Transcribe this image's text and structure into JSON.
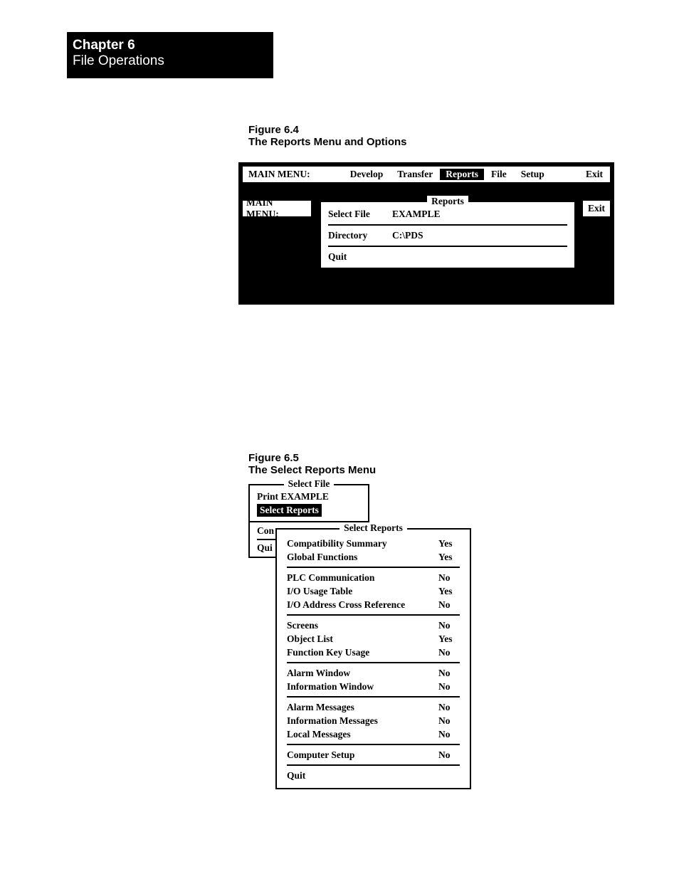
{
  "chapter": {
    "number": "Chapter 6",
    "title": "File Operations"
  },
  "figure64": {
    "caption_num": "Figure 6.4",
    "caption_text": "The Reports Menu and Options",
    "main_menu_label": "MAIN MENU:",
    "menu_items": {
      "develop": "Develop",
      "transfer": "Transfer",
      "reports": "Reports",
      "file": "File",
      "setup": "Setup",
      "exit": "Exit"
    },
    "sub": {
      "main_menu_label": "MAIN MENU:",
      "panel_title": "Reports",
      "select_file_label": "Select File",
      "select_file_value": "EXAMPLE",
      "directory_label": "Directory",
      "directory_value": "C:\\PDS",
      "quit_label": "Quit",
      "exit_label": "Exit"
    }
  },
  "figure65": {
    "caption_num": "Figure 6.5",
    "caption_text": "The Select Reports Menu",
    "select_file_title": "Select File",
    "print_label": "Print",
    "print_value": "EXAMPLE",
    "select_reports_label": "Select Reports",
    "back_item_con": "Con",
    "back_item_qui": "Qui",
    "panel_title": "Select Reports",
    "groups": [
      [
        {
          "label": "Compatibility Summary",
          "value": "Yes"
        },
        {
          "label": "Global Functions",
          "value": "Yes"
        }
      ],
      [
        {
          "label": "PLC Communication",
          "value": "No"
        },
        {
          "label": "I/O Usage Table",
          "value": "Yes"
        },
        {
          "label": "I/O Address Cross Reference",
          "value": "No"
        }
      ],
      [
        {
          "label": "Screens",
          "value": "No"
        },
        {
          "label": "Object List",
          "value": "Yes"
        },
        {
          "label": "Function Key Usage",
          "value": "No"
        }
      ],
      [
        {
          "label": "Alarm Window",
          "value": "No"
        },
        {
          "label": "Information Window",
          "value": "No"
        }
      ],
      [
        {
          "label": "Alarm Messages",
          "value": "No"
        },
        {
          "label": "Information Messages",
          "value": "No"
        },
        {
          "label": "Local Messages",
          "value": "No"
        }
      ],
      [
        {
          "label": "Computer Setup",
          "value": "No"
        }
      ]
    ],
    "quit_label": "Quit"
  }
}
